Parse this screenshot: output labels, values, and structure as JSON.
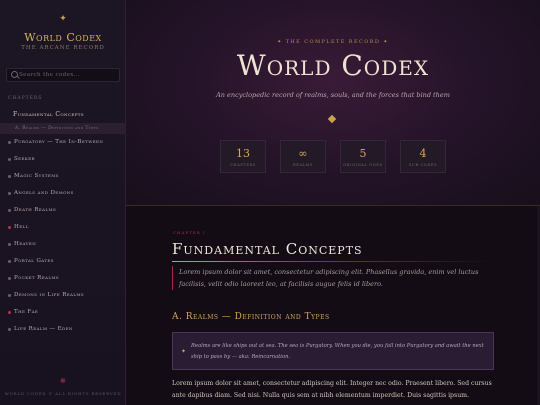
{
  "sidebar": {
    "brand_star": "✦",
    "brand_title": "World Codex",
    "brand_subtitle": "THE ARCANE RECORD",
    "search_placeholder": "Search the codex...",
    "nav_heading": "CHAPTERS",
    "items": [
      {
        "label": "Fundamental Concepts"
      },
      {
        "label": "A. Realms — Definition and Types"
      },
      {
        "label": "Purgatory — The In-Between"
      },
      {
        "label": "Seeker"
      },
      {
        "label": "Magic Systems"
      },
      {
        "label": "Angels and Demons"
      },
      {
        "label": "Death Realms"
      },
      {
        "label": "Hell"
      },
      {
        "label": "Heaven"
      },
      {
        "label": "Portal Gates"
      },
      {
        "label": "Pocket Realms"
      },
      {
        "label": "Demons in Life Realms"
      },
      {
        "label": "The Fae"
      },
      {
        "label": "Life Realm — Eden"
      }
    ],
    "footer_icon": "❋",
    "footer": "WORLD CODEX © ALL RIGHTS RESERVED"
  },
  "hero": {
    "eyebrow": "✦ THE COMPLETE RECORD ✦",
    "title": "World Codex",
    "subtitle": "An encyclopedic record of realms, souls, and the forces that bind them",
    "stats": [
      {
        "value": "13",
        "label": "CHAPTERS"
      },
      {
        "value": "∞",
        "label": "REALMS"
      },
      {
        "value": "5",
        "label": "ORIGINAL GODS"
      },
      {
        "value": "4",
        "label": "SUB-CODES"
      }
    ]
  },
  "content": {
    "chapter_tag": "CHAPTER I",
    "title": "Fundamental Concepts",
    "lead": "Lorem ipsum dolor sit amet, consectetur adipiscing elit. Phasellus gravida, enim vel luctus facilisis, velit odio laoreet leo, at facilisis augue felis id libero.",
    "subhead": "A. Realms — Definition and Types",
    "callout_icon": "✦",
    "callout": "Realms are like ships out at sea. The sea is Purgatory. When you die, you fall into Purgatory and await the next ship to pass by — aka: Reincarnation.",
    "body": "Lorem ipsum dolor sit amet, consectetur adipiscing elit. Integer nec odio. Praesent libero. Sed cursus ante dapibus diam. Sed nisi. Nulla quis sem at nibh elementum imperdiet. Duis sagittis ipsum."
  },
  "colors": {
    "accent_gold": "#c9a24a",
    "accent_red": "#a32d44",
    "background": "#150d18"
  }
}
